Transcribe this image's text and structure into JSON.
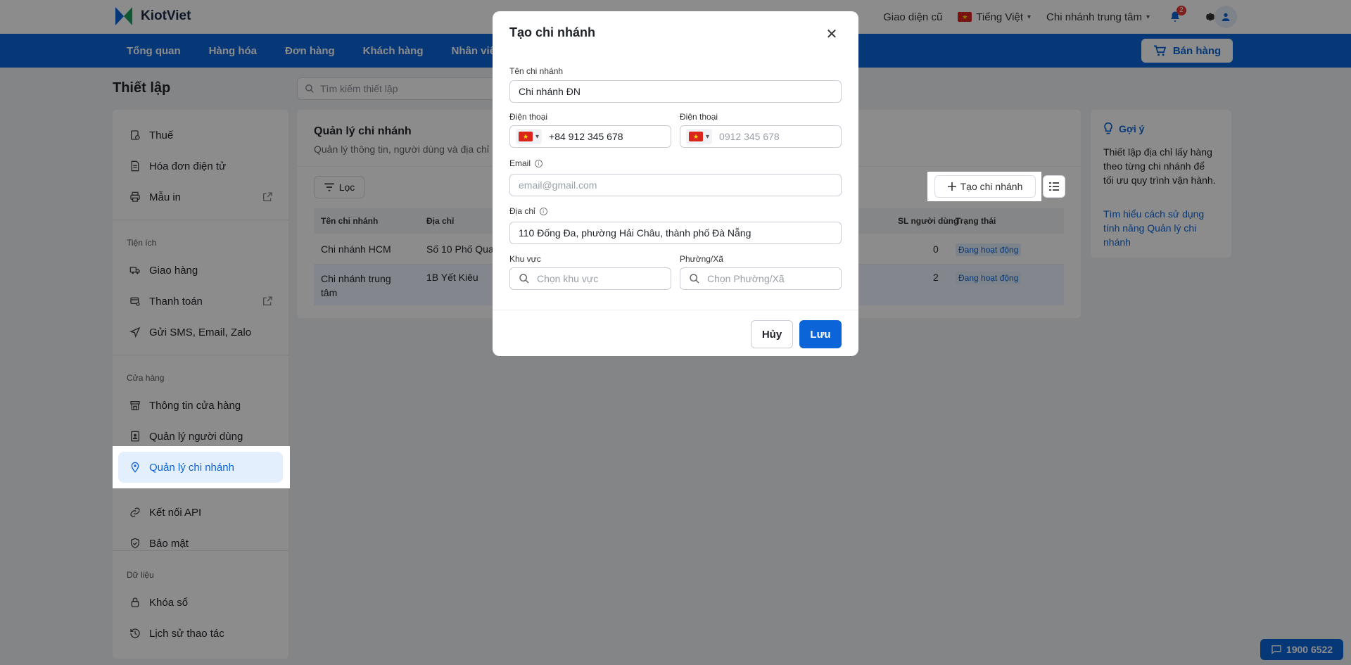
{
  "app": {
    "logo_text": "KiotViet"
  },
  "topbar": {
    "old_ui_label": "Giao diện cũ",
    "language_label": "Tiếng Việt",
    "branch_label": "Chi nhánh trung tâm",
    "notification_count": "2"
  },
  "nav": {
    "items": [
      "Tổng quan",
      "Hàng hóa",
      "Đơn hàng",
      "Khách hàng",
      "Nhân viên"
    ],
    "sell_label": "Bán hàng"
  },
  "page": {
    "title": "Thiết lập",
    "search_placeholder": "Tìm kiếm thiết lập"
  },
  "sidebar": {
    "items": [
      {
        "label": "Thuế",
        "icon": "tax-icon"
      },
      {
        "label": "Hóa đơn điện tử",
        "icon": "invoice-icon"
      },
      {
        "label": "Mẫu in",
        "icon": "printer-icon"
      },
      {
        "label": "Giao hàng",
        "icon": "truck-icon"
      },
      {
        "label": "Thanh toán",
        "icon": "payment-icon"
      },
      {
        "label": "Gửi SMS, Email, Zalo",
        "icon": "send-icon"
      },
      {
        "label": "Thông tin cửa hàng",
        "icon": "store-icon"
      },
      {
        "label": "Quản lý người dùng",
        "icon": "user-badge-icon"
      },
      {
        "label": "Quản lý chi nhánh",
        "icon": "location-icon"
      },
      {
        "label": "Kết nối API",
        "icon": "link-icon"
      },
      {
        "label": "Bảo mật",
        "icon": "shield-icon"
      },
      {
        "label": "Khóa sổ",
        "icon": "lock-icon"
      },
      {
        "label": "Lịch sử thao tác",
        "icon": "history-icon"
      }
    ],
    "sections": [
      "Tiện ích",
      "Cửa hàng",
      "Dữ liệu"
    ]
  },
  "main": {
    "title": "Quản lý chi nhánh",
    "subtitle": "Quản lý thông tin, người dùng và địa chỉ",
    "filter_label": "Lọc",
    "create_label": "Tạo chi nhánh",
    "columns": [
      "Tên chi nhánh",
      "Địa chỉ",
      "SL người dùng",
      "Trạng thái"
    ],
    "rows": [
      {
        "name": "Chi nhánh HCM",
        "address": "Số 10 Phố Qua",
        "users": "0",
        "status": "Đang hoạt động"
      },
      {
        "name": "Chi nhánh trung tâm",
        "address": "1B Yết Kiêu",
        "users": "2",
        "status": "Đang hoạt động"
      }
    ]
  },
  "hint": {
    "title": "Gợi ý",
    "text": "Thiết lập địa chỉ lấy hàng theo từng chi nhánh để tối ưu quy trình vận hành.",
    "link": "Tìm hiểu cách sử dụng tính năng Quản lý chi nhánh"
  },
  "hotline": "1900 6522",
  "modal": {
    "title": "Tạo chi nhánh",
    "name_label": "Tên chi nhánh",
    "name_value": "Chi nhánh ĐN",
    "phone1_label": "Điện thoại",
    "phone1_value": "+84 912 345 678",
    "phone2_label": "Điện thoại",
    "phone2_placeholder": "0912 345 678",
    "email_label": "Email",
    "email_placeholder": "email@gmail.com",
    "address_label": "Địa chỉ",
    "address_value": "110 Đống Đa, phường Hải Châu, thành phố Đà Nẵng",
    "region_label": "Khu vực",
    "region_placeholder": "Chọn khu vực",
    "ward_label": "Phường/Xã",
    "ward_placeholder": "Chọn Phường/Xã",
    "cancel_label": "Hủy",
    "save_label": "Lưu"
  },
  "colors": {
    "primary": "#0b64d8",
    "status_bg": "#e4effd",
    "flag": "#da251d"
  }
}
